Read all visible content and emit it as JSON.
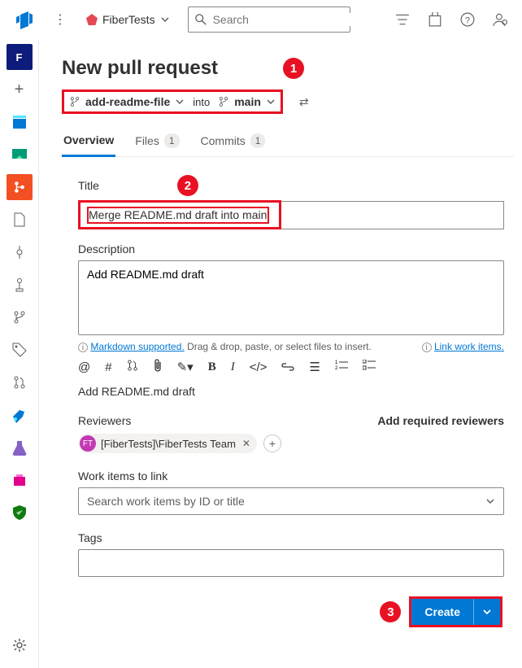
{
  "header": {
    "project_name": "FiberTests",
    "search_placeholder": "Search"
  },
  "page": {
    "title": "New pull request",
    "source_branch": "add-readme-file",
    "into_label": "into",
    "target_branch": "main"
  },
  "tabs": {
    "overview": "Overview",
    "files": "Files",
    "files_count": "1",
    "commits": "Commits",
    "commits_count": "1"
  },
  "form": {
    "title_label": "Title",
    "title_value": "Merge README.md draft into main",
    "description_label": "Description",
    "description_value": "Add README.md draft",
    "markdown_hint_link": "Markdown supported.",
    "markdown_hint_rest": " Drag & drop, paste, or select files to insert.",
    "link_work_items": "Link work items.",
    "preview_text": "Add README.md draft",
    "reviewers_label": "Reviewers",
    "add_required_reviewers": "Add required reviewers",
    "reviewer_chip": "[FiberTests]\\FiberTests Team",
    "reviewer_initials": "FT",
    "work_items_label": "Work items to link",
    "work_items_placeholder": "Search work items by ID or title",
    "tags_label": "Tags",
    "create_label": "Create"
  },
  "annotations": {
    "n1": "1",
    "n2": "2",
    "n3": "3"
  }
}
